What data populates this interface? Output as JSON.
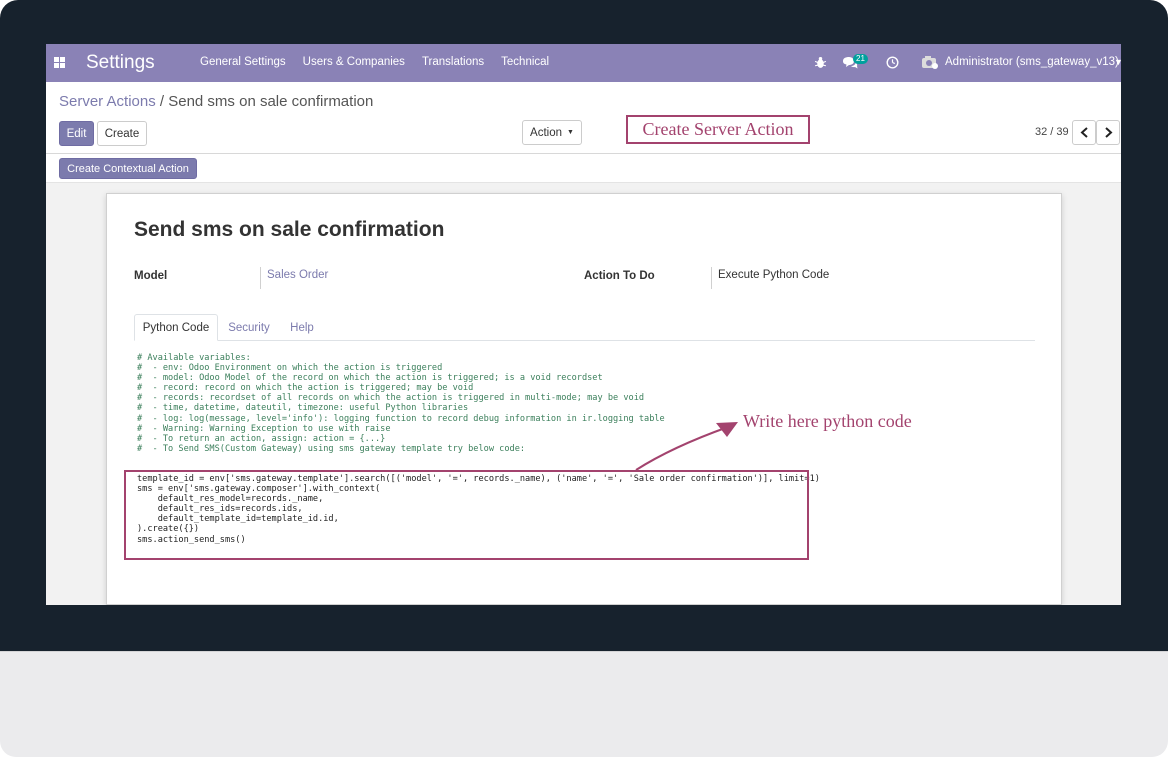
{
  "navbar": {
    "brand": "Settings",
    "menu": [
      "General Settings",
      "Users & Companies",
      "Translations",
      "Technical"
    ],
    "message_count": "21",
    "user": "Administrator (sms_gateway_v13)"
  },
  "breadcrumb": {
    "parent": "Server Actions",
    "separator": " / ",
    "current": "Send sms on sale confirmation"
  },
  "buttons": {
    "edit": "Edit",
    "create": "Create",
    "action": "Action",
    "create_contextual": "Create Contextual Action"
  },
  "pager": {
    "text": "32 / 39"
  },
  "annotations": {
    "server_action": "Create Server Action",
    "python_code": "Write here python code"
  },
  "record": {
    "title": "Send sms on sale confirmation",
    "model_label": "Model",
    "model_value": "Sales Order",
    "action_label": "Action To Do",
    "action_value": "Execute Python Code"
  },
  "tabs": [
    "Python Code",
    "Security",
    "Help"
  ],
  "code": {
    "comment_lines": [
      "# Available variables:",
      "#  - env: Odoo Environment on which the action is triggered",
      "#  - model: Odoo Model of the record on which the action is triggered; is a void recordset",
      "#  - record: record on which the action is triggered; may be void",
      "#  - records: recordset of all records on which the action is triggered in multi-mode; may be void",
      "#  - time, datetime, dateutil, timezone: useful Python libraries",
      "#  - log: log(message, level='info'): logging function to record debug information in ir.logging table",
      "#  - Warning: Warning Exception to use with raise",
      "#  - To return an action, assign: action = {...}",
      "",
      "#  - To Send SMS(Custom Gateway) using sms gateway template try below code:"
    ],
    "lines": [
      "template_id = env['sms.gateway.template'].search([('model', '=', records._name), ('name', '=', 'Sale order confirmation')], limit=1)",
      "sms = env['sms.gateway.composer'].with_context(",
      "    default_res_model=records._name,",
      "    default_res_ids=records.ids,",
      "    default_template_id=template_id.id,",
      ").create({})",
      "sms.action_send_sms()"
    ]
  },
  "colors": {
    "navbar": "#8a82b6",
    "primary": "#7c7bad",
    "annotation": "#a3436e",
    "comment": "#3b7f5b",
    "bezel": "#17222d"
  }
}
